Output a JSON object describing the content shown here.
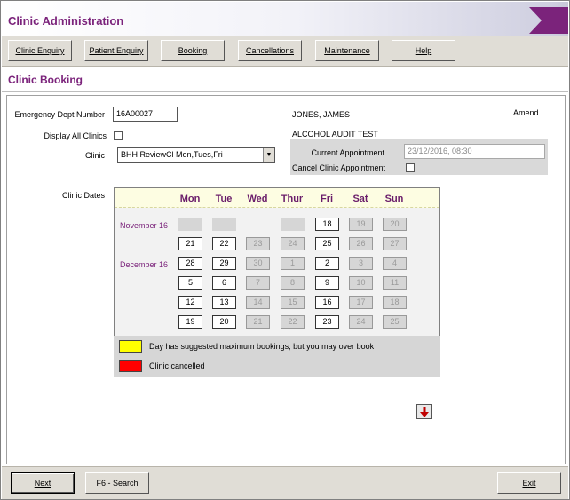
{
  "app": {
    "title": "Clinic Administration"
  },
  "nav": {
    "clinic_enquiry": "Clinic Enquiry",
    "patient_enquiry": "Patient Enquiry",
    "booking": "Booking",
    "cancellations": "Cancellations",
    "maintenance": "Maintenance",
    "help": "Help"
  },
  "page": {
    "title": "Clinic Booking"
  },
  "form": {
    "ed_number_label": "Emergency Dept Number",
    "ed_number_value": "16A00027",
    "display_all_label": "Display All Clinics",
    "display_all_checked": false,
    "clinic_label": "Clinic",
    "clinic_value": "BHH ReviewCl Mon,Tues,Fri",
    "clinic_dates_label": "Clinic Dates"
  },
  "patient": {
    "name": "JONES, JAMES",
    "mode": "Amend",
    "test": "ALCOHOL AUDIT TEST",
    "current_appt_label": "Current Appointment",
    "current_appt_value": "23/12/2016, 08:30",
    "cancel_label": "Cancel Clinic Appointment",
    "cancel_checked": false
  },
  "calendar": {
    "days": [
      "Mon",
      "Tue",
      "Wed",
      "Thur",
      "Fri",
      "Sat",
      "Sun"
    ],
    "months": [
      "November 16",
      "December 16"
    ],
    "rows": [
      [
        {
          "d": "",
          "s": "blank"
        },
        {
          "d": "",
          "s": "blank"
        },
        {
          "d": "",
          "s": "none"
        },
        {
          "d": "",
          "s": "blank"
        },
        {
          "d": "18",
          "s": "on"
        },
        {
          "d": "19",
          "s": "dis"
        },
        {
          "d": "20",
          "s": "dis"
        }
      ],
      [
        {
          "d": "21",
          "s": "on"
        },
        {
          "d": "22",
          "s": "on"
        },
        {
          "d": "23",
          "s": "dis"
        },
        {
          "d": "24",
          "s": "dis"
        },
        {
          "d": "25",
          "s": "on"
        },
        {
          "d": "26",
          "s": "dis"
        },
        {
          "d": "27",
          "s": "dis"
        }
      ],
      [
        {
          "d": "28",
          "s": "on"
        },
        {
          "d": "29",
          "s": "on"
        },
        {
          "d": "30",
          "s": "dis"
        },
        {
          "d": "1",
          "s": "dis"
        },
        {
          "d": "2",
          "s": "on"
        },
        {
          "d": "3",
          "s": "dis"
        },
        {
          "d": "4",
          "s": "dis"
        }
      ],
      [
        {
          "d": "5",
          "s": "on"
        },
        {
          "d": "6",
          "s": "on"
        },
        {
          "d": "7",
          "s": "dis"
        },
        {
          "d": "8",
          "s": "dis"
        },
        {
          "d": "9",
          "s": "on"
        },
        {
          "d": "10",
          "s": "dis"
        },
        {
          "d": "11",
          "s": "dis"
        }
      ],
      [
        {
          "d": "12",
          "s": "on"
        },
        {
          "d": "13",
          "s": "on"
        },
        {
          "d": "14",
          "s": "dis"
        },
        {
          "d": "15",
          "s": "dis"
        },
        {
          "d": "16",
          "s": "on"
        },
        {
          "d": "17",
          "s": "dis"
        },
        {
          "d": "18",
          "s": "dis"
        }
      ],
      [
        {
          "d": "19",
          "s": "on"
        },
        {
          "d": "20",
          "s": "on"
        },
        {
          "d": "21",
          "s": "dis"
        },
        {
          "d": "22",
          "s": "dis"
        },
        {
          "d": "23",
          "s": "on"
        },
        {
          "d": "24",
          "s": "dis"
        },
        {
          "d": "25",
          "s": "dis"
        }
      ]
    ],
    "scroll_icon": "arrow-down-icon"
  },
  "legend": {
    "items": [
      {
        "label": "Day has suggested maximum bookings, but you may over book",
        "color": "#ffff00"
      },
      {
        "label": "Clinic cancelled",
        "color": "#ff0000"
      }
    ]
  },
  "footer": {
    "next": "Next",
    "search": "F6 - Search",
    "exit": "Exit"
  },
  "colors": {
    "accent": "#7b237b",
    "face": "#e0ddd6"
  }
}
